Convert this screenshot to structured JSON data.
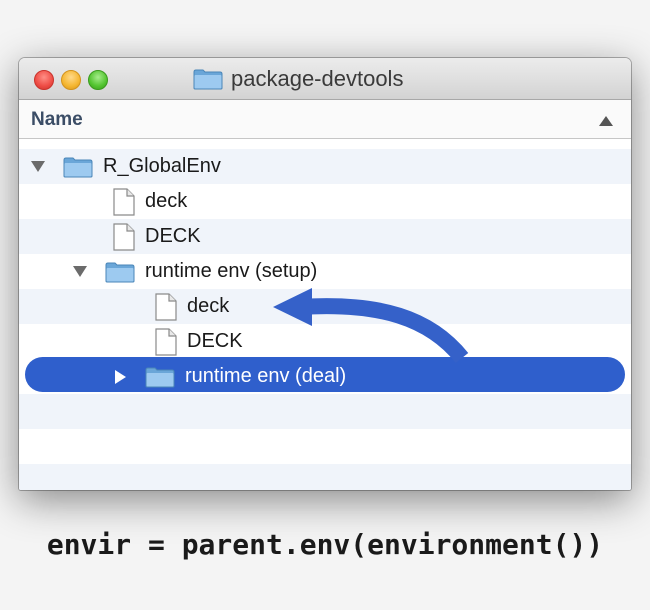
{
  "window": {
    "title": "package-devtools",
    "column_header": "Name"
  },
  "tree": [
    {
      "label": "R_GlobalEnv",
      "type": "folder",
      "disclosure": "expanded"
    },
    {
      "label": "deck",
      "type": "file"
    },
    {
      "label": "DECK",
      "type": "file"
    },
    {
      "label": "runtime env (setup)",
      "type": "folder",
      "disclosure": "expanded"
    },
    {
      "label": "deck",
      "type": "file"
    },
    {
      "label": "DECK",
      "type": "file"
    },
    {
      "label": "runtime env (deal)",
      "type": "folder",
      "disclosure": "collapsed",
      "selected": true
    }
  ],
  "code_caption": "envir = parent.env(environment())",
  "colors": {
    "selection": "#2f5fcc",
    "arrow": "#3561c9",
    "folder": "#7fb3dd"
  }
}
